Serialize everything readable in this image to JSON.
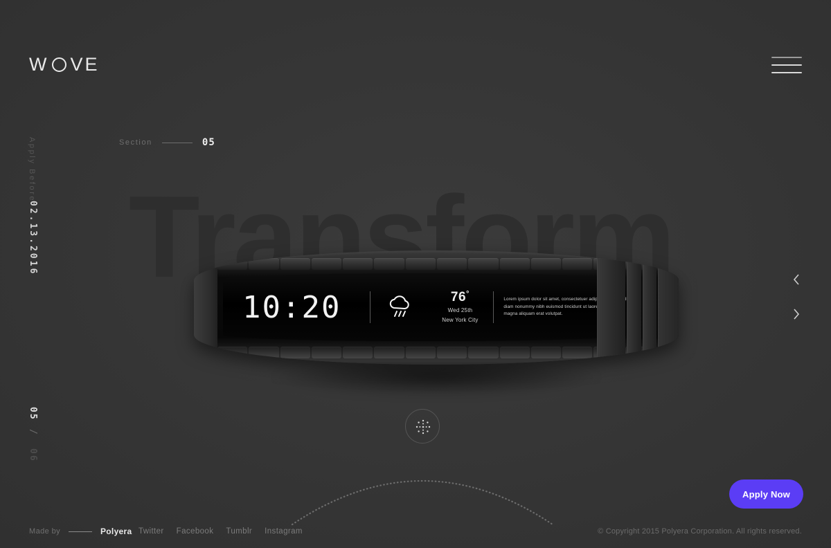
{
  "brand": {
    "logo_left": "W",
    "logo_mid_icon": "circle-o",
    "logo_right": "VE"
  },
  "header": {
    "menu_icon": "hamburger-icon"
  },
  "rail": {
    "apply_before_label": "Apply Before",
    "apply_before_date": "02.13.2016",
    "slide_current": "05",
    "slide_separator": "/",
    "slide_total": "06"
  },
  "section": {
    "label": "Section",
    "number": "05"
  },
  "hero": {
    "watermark": "Transform"
  },
  "watch": {
    "time": "10:20",
    "weather_icon": "rain-cloud-icon",
    "temperature": "76",
    "degree": "°",
    "day": "Wed 25th",
    "city": "New York City",
    "body_text": "Lorem ipsum dolor sit amet, consectetuer adipiscing elit, sed diam nonummy nibh euismod tincidunt ut laoreet dolore magna aliquam erat volutpat."
  },
  "controls": {
    "scroll_orb_icon": "radial-dots-icon",
    "prev_icon": "chevron-left-icon",
    "next_icon": "chevron-right-icon",
    "apply_now_label": "Apply Now"
  },
  "footer": {
    "made_by_label": "Made by",
    "made_by_brand": "Polyera",
    "social": [
      {
        "label": "Twitter"
      },
      {
        "label": "Facebook"
      },
      {
        "label": "Tumblr"
      },
      {
        "label": "Instagram"
      }
    ],
    "copyright": "© Copyright 2015 Polyera Corporation. All rights reserved."
  },
  "colors": {
    "background": "#353535",
    "accent": "#5b3df5",
    "text_primary": "#ededed",
    "text_muted": "#6e6e6e",
    "watermark": "#2e2e2e"
  }
}
